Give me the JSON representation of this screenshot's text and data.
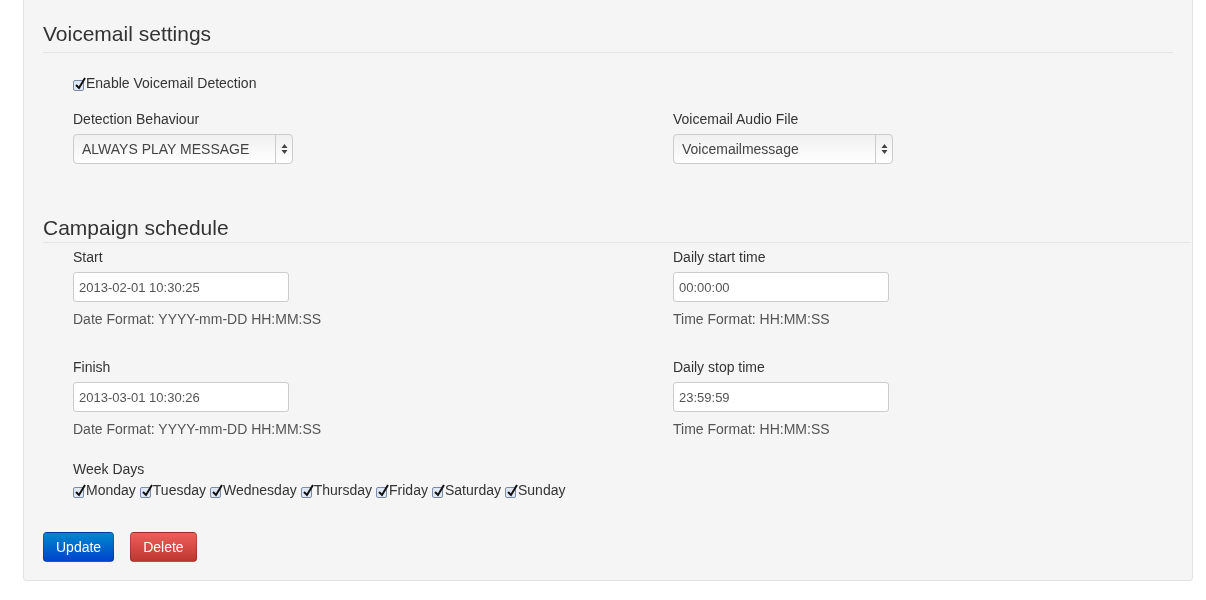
{
  "voicemail": {
    "title": "Voicemail settings",
    "enable": {
      "label": "Enable Voicemail Detection",
      "checked": true
    },
    "detection": {
      "label": "Detection Behaviour",
      "value": "ALWAYS PLAY MESSAGE"
    },
    "audio": {
      "label": "Voicemail Audio File",
      "value": "Voicemailmessage"
    }
  },
  "schedule": {
    "title": "Campaign schedule",
    "fields": [
      {
        "label": "Start",
        "value": "2013-02-01 10:30:25",
        "help": "Date Format: YYYY-mm-DD HH:MM:SS"
      },
      {
        "label": "Daily start time",
        "value": "00:00:00",
        "help": "Time Format: HH:MM:SS"
      },
      {
        "label": "Finish",
        "value": "2013-03-01 10:30:26",
        "help": "Date Format: YYYY-mm-DD HH:MM:SS"
      },
      {
        "label": "Daily stop time",
        "value": "23:59:59",
        "help": "Time Format: HH:MM:SS"
      }
    ],
    "weekdays_label": "Week Days",
    "weekdays": [
      {
        "label": "Monday",
        "checked": true
      },
      {
        "label": "Tuesday",
        "checked": true
      },
      {
        "label": "Wednesday",
        "checked": true
      },
      {
        "label": "Thursday",
        "checked": true
      },
      {
        "label": "Friday",
        "checked": true
      },
      {
        "label": "Saturday",
        "checked": true
      },
      {
        "label": "Sunday",
        "checked": true
      }
    ]
  },
  "buttons": [
    {
      "label": "Update",
      "kind": "primary"
    },
    {
      "label": "Delete",
      "kind": "danger"
    }
  ]
}
